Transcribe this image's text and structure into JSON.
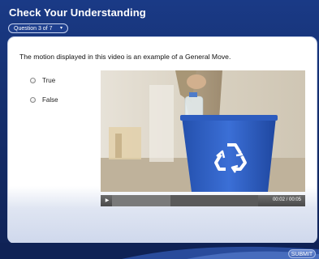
{
  "header": {
    "title": "Check Your Understanding",
    "question_selector": "Question 3 of 7",
    "selector_icon": "chevron-down-icon"
  },
  "question": {
    "text": "The motion displayed in this video is an example of a General Move.",
    "options": [
      {
        "label": "True",
        "selected": false
      },
      {
        "label": "False",
        "selected": false
      }
    ]
  },
  "video": {
    "elapsed": "00:02",
    "duration": "00:05",
    "time_display": "00:02 / 00:05",
    "progress_fraction": 0.4,
    "play_icon": "play-icon",
    "scene_icon": "recycle-icon"
  },
  "footer": {
    "submit_label": "SUBMIT"
  },
  "colors": {
    "frame": "#1a3a86",
    "panel": "#ffffff",
    "bin": "#2f5fc0",
    "submit": "#4668b8"
  }
}
